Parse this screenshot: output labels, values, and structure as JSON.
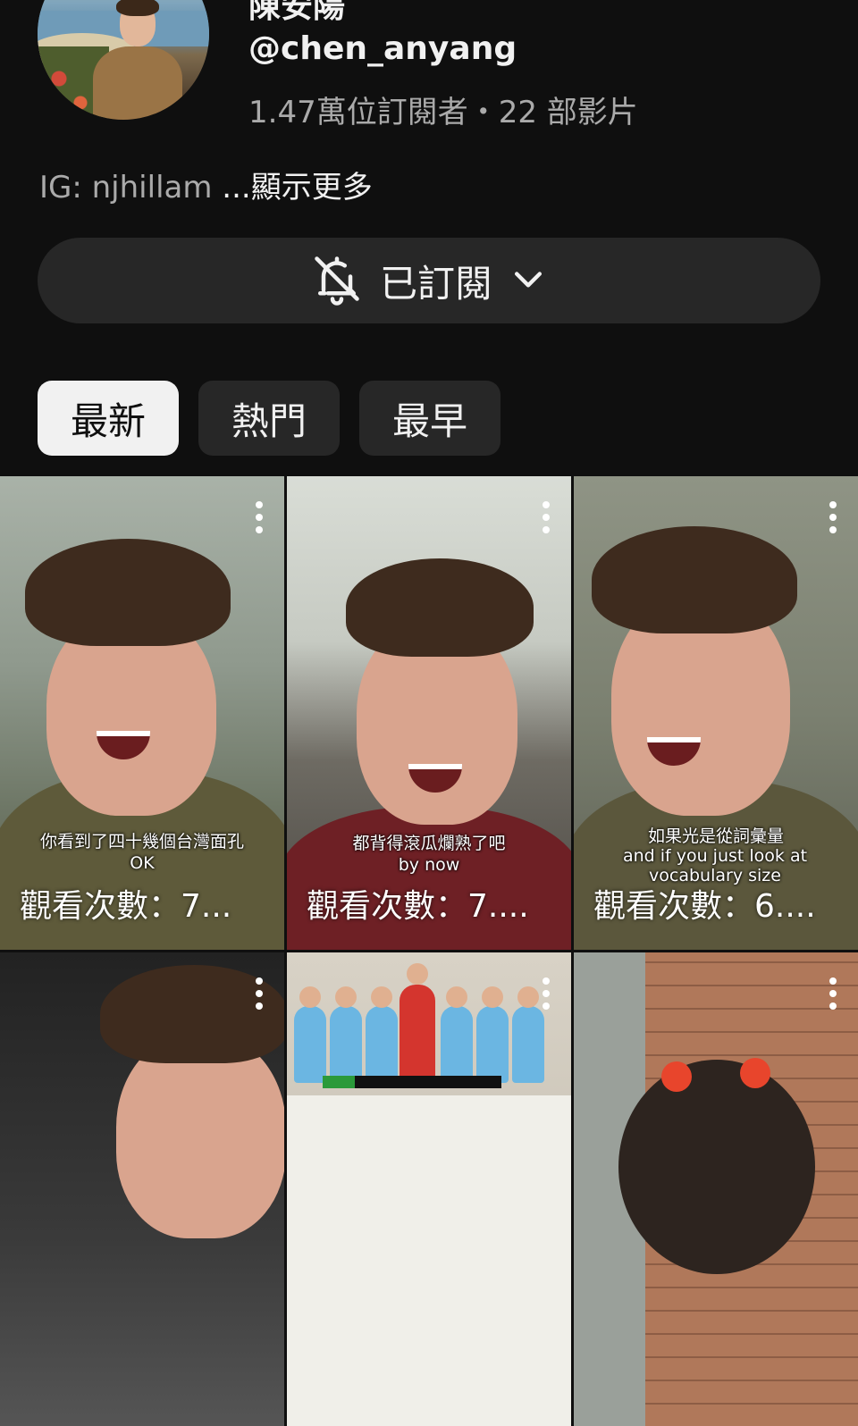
{
  "channel": {
    "name": "陳安陽",
    "handle": "@chen_anyang",
    "stats": "1.47萬位訂閱者・22 部影片",
    "description_prefix": "IG: njhillam ",
    "description_more": "...顯示更多"
  },
  "subscribe": {
    "label": "已訂閱",
    "icon": "bell-off-icon"
  },
  "chips": [
    {
      "label": "最新",
      "active": true
    },
    {
      "label": "熱門",
      "active": false
    },
    {
      "label": "最早",
      "active": false
    }
  ],
  "videos": [
    {
      "subtitle_zh": "你看到了四十幾個台灣面孔",
      "subtitle_en": "OK",
      "views": "觀看次數：7..."
    },
    {
      "subtitle_zh": "都背得滾瓜爛熟了吧",
      "subtitle_en": "by now",
      "views": "觀看次數：7...."
    },
    {
      "subtitle_zh": "如果光是從詞彙量",
      "subtitle_en": "and if you just look at vocabulary size",
      "views": "觀看次數：6...."
    },
    {
      "subtitle_zh": "",
      "subtitle_en": "",
      "views": ""
    },
    {
      "subtitle_zh": "",
      "subtitle_en": "",
      "views": ""
    },
    {
      "subtitle_zh": "",
      "subtitle_en": "",
      "views": ""
    }
  ]
}
